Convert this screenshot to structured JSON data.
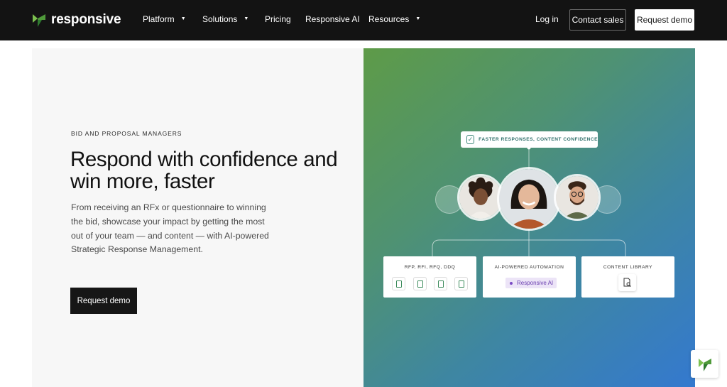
{
  "nav": {
    "logo_text": "responsive",
    "items": [
      {
        "label": "Platform",
        "caret": true
      },
      {
        "label": "Solutions",
        "caret": true
      },
      {
        "label": "Pricing",
        "caret": false
      },
      {
        "label": "Responsive AI",
        "caret": false
      },
      {
        "label": "Resources",
        "caret": true
      }
    ],
    "login": "Log in",
    "contact_sales": "Contact sales",
    "request_demo": "Request demo",
    "caret_icon": "▼"
  },
  "hero": {
    "eyebrow": "BID AND PROPOSAL MANAGERS",
    "headline": "Respond with confidence and win more, faster",
    "description": "From receiving an RFx or questionnaire to winning the bid, showcase your impact by getting the most out of your team — and content — with AI-powered Strategic Response Management.",
    "cta": "Request demo"
  },
  "visual": {
    "badge": "FASTER RESPONSES, CONTENT CONFIDENCE",
    "check_icon": "✓",
    "cards": [
      {
        "title": "RFP, RFI, RFQ, DDQ"
      },
      {
        "title": "AI-POWERED AUTOMATION",
        "pill": "Responsive AI"
      },
      {
        "title": "CONTENT LIBRARY"
      }
    ]
  },
  "colors": {
    "nav_bg": "#131313",
    "brand_green": "#5c9e3c",
    "ai_purple": "#7a4ac4"
  }
}
